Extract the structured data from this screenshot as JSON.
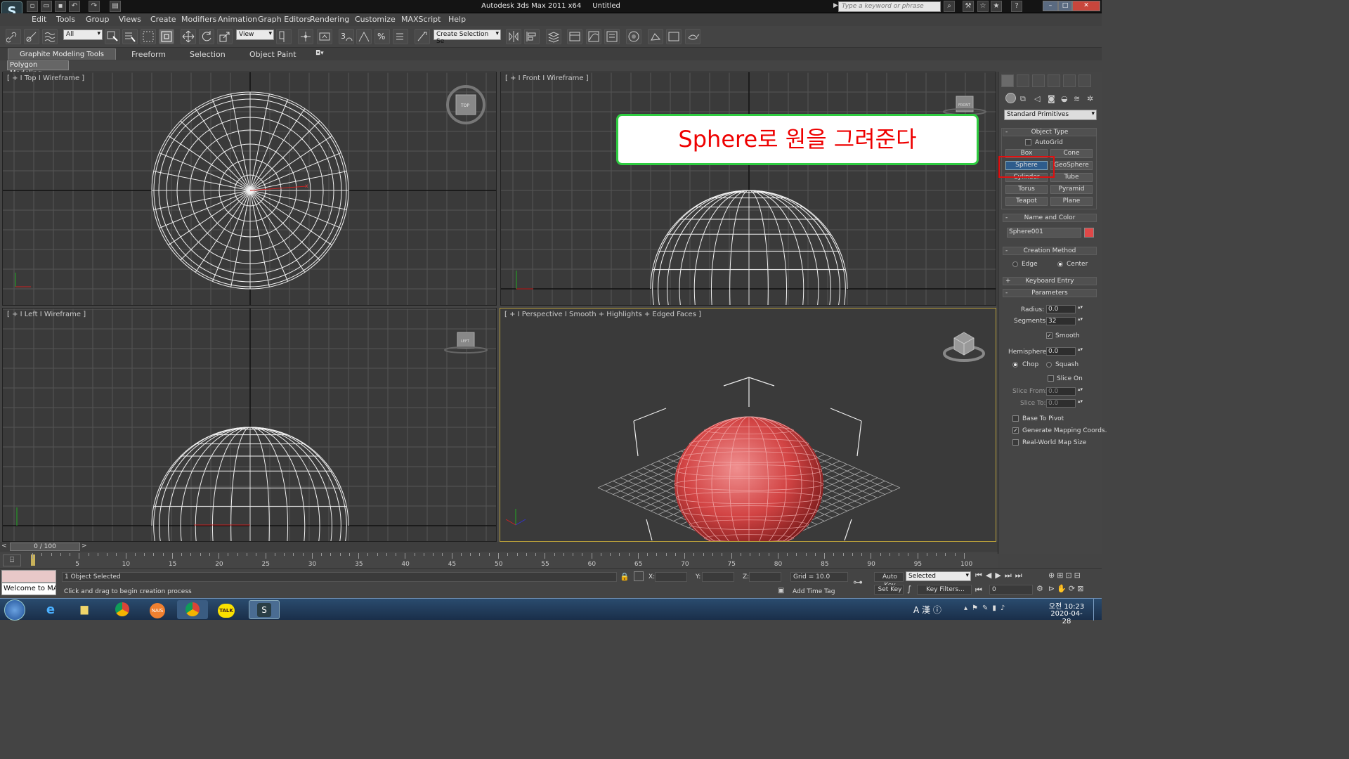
{
  "window": {
    "app_title": "Autodesk 3ds Max  2011 x64",
    "doc_title": "Untitled",
    "search_placeholder": "Type a keyword or phrase",
    "logo": "S"
  },
  "menu": [
    "Edit",
    "Tools",
    "Group",
    "Views",
    "Create",
    "Modifiers",
    "Animation",
    "Graph Editors",
    "Rendering",
    "Customize",
    "MAXScript",
    "Help"
  ],
  "toolbar": {
    "selection_filter": "All",
    "reference_coord": "View",
    "named_selection": "Create Selection Se"
  },
  "ribbon": {
    "tabs": [
      "Graphite Modeling Tools",
      "Freeform",
      "Selection",
      "Object Paint"
    ],
    "panel": "Polygon Modeling"
  },
  "viewports": {
    "top": {
      "label": "[ + I Top I Wireframe ]",
      "gizmo": "TOP"
    },
    "front": {
      "label": "[ + I Front I Wireframe ]",
      "gizmo": "FRONT"
    },
    "left": {
      "label": "[ + I Left I Wireframe ]",
      "gizmo": "LEFT"
    },
    "perspective": {
      "label": "[ + I Perspective I Smooth + Highlights + Edged Faces ]"
    }
  },
  "callout": "Sphere로 원을 그려준다",
  "command_panel": {
    "category": "Standard Primitives",
    "object_type": {
      "title": "Object Type",
      "autogrid": "AutoGrid",
      "buttons": [
        "Box",
        "Cone",
        "Sphere",
        "GeoSphere",
        "Cylinder",
        "Tube",
        "Torus",
        "Pyramid",
        "Teapot",
        "Plane"
      ]
    },
    "name_color": {
      "title": "Name and Color",
      "name": "Sphere001",
      "color": "#e04848"
    },
    "creation_method": {
      "title": "Creation Method",
      "edge": "Edge",
      "center": "Center"
    },
    "keyboard_entry": "Keyboard Entry",
    "parameters": {
      "title": "Parameters",
      "radius_label": "Radius:",
      "radius": "0.0",
      "segments_label": "Segments:",
      "segments": "32",
      "smooth": "Smooth",
      "hemisphere_label": "Hemisphere:",
      "hemisphere": "0.0",
      "chop": "Chop",
      "squash": "Squash",
      "slice_on": "Slice On",
      "slice_from_label": "Slice From:",
      "slice_from": "0.0",
      "slice_to_label": "Slice To:",
      "slice_to": "0.0",
      "base_to_pivot": "Base To Pivot",
      "gen_mapping": "Generate Mapping Coords.",
      "real_world": "Real-World Map Size"
    }
  },
  "timeline": {
    "frame": "0 / 100",
    "ticks": [
      "5",
      "10",
      "15",
      "20",
      "25",
      "30",
      "35",
      "40",
      "45",
      "50",
      "55",
      "60",
      "65",
      "70",
      "75",
      "80",
      "85",
      "90",
      "95",
      "100"
    ]
  },
  "status": {
    "maxscript": "Welcome to MA",
    "selected": "1 Object Selected",
    "prompt": "Click and drag to begin creation process",
    "x_label": "X:",
    "y_label": "Y:",
    "z_label": "Z:",
    "grid": "Grid = 10.0",
    "add_time_tag": "Add Time Tag",
    "auto_key": "Auto Key",
    "set_key": "Set Key",
    "key_mode": "Selected",
    "key_filters": "Key Filters...",
    "frame_field": "0"
  },
  "taskbar": {
    "time": "오전 10:23",
    "date": "2020-04-28",
    "kakao": "TALK",
    "nais": "NAIS"
  }
}
